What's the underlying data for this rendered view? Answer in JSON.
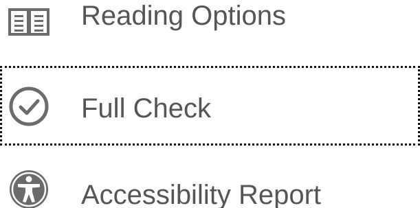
{
  "menu": {
    "items": [
      {
        "label": "Reading Options",
        "icon": "reading-options-icon",
        "focused": false
      },
      {
        "label": "Full Check",
        "icon": "check-circle-icon",
        "focused": true
      },
      {
        "label": "Accessibility Report",
        "icon": "accessibility-icon",
        "focused": false
      }
    ]
  },
  "colors": {
    "text": "#555555",
    "icon": "#6b6b6b",
    "focus_outline": "#111111",
    "background": "#ffffff"
  }
}
